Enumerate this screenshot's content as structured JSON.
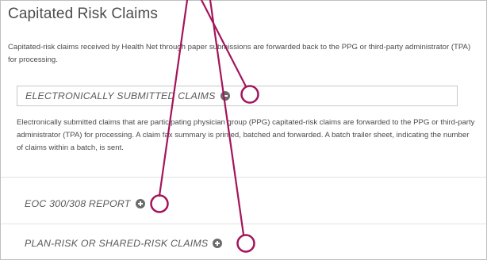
{
  "page": {
    "title": "Capitated Risk Claims",
    "intro": "Capitated-risk claims received by Health Net through paper submissions are forwarded back to the PPG or third-party administrator (TPA) for processing."
  },
  "sections": [
    {
      "title": "ELECTRONICALLY SUBMITTED CLAIMS",
      "state": "expanded",
      "icon": "minus-circle-icon",
      "body": "Electronically submitted claims that are participating physician group (PPG) capitated-risk claims are forwarded to the PPG or third-party administrator (TPA) for processing. A claim fax summary is printed, batched and forwarded. A batch trailer sheet, indicating the number of claims within a batch, is sent."
    },
    {
      "title": "EOC 300/308 REPORT",
      "state": "collapsed",
      "icon": "plus-circle-icon"
    },
    {
      "title": "PLAN-RISK OR SHARED-RISK CLAIMS",
      "state": "collapsed",
      "icon": "plus-circle-icon"
    }
  ],
  "colors": {
    "callout": "#a3145b",
    "icon": "#6b6b6b",
    "text": "#4a4a4a",
    "border": "#bfbfbf"
  }
}
